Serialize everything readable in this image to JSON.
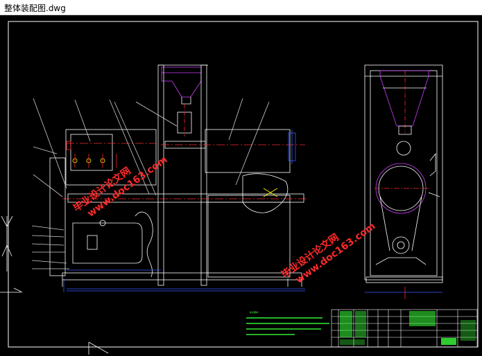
{
  "window": {
    "title": "整体装配图.dwg"
  },
  "watermark": {
    "line1": "毕业设计论文网",
    "line2": "www.doc163.com"
  },
  "colors": {
    "background": "#000000",
    "frame": "#ffffff",
    "red": "#ff2a2a",
    "green": "#39ff39",
    "blue": "#3a5cff",
    "magenta": "#d040ff",
    "yellow": "#ffff00",
    "cyan": "#33e0ff"
  },
  "icons": {
    "ucs": "ucs-axis-icon"
  }
}
